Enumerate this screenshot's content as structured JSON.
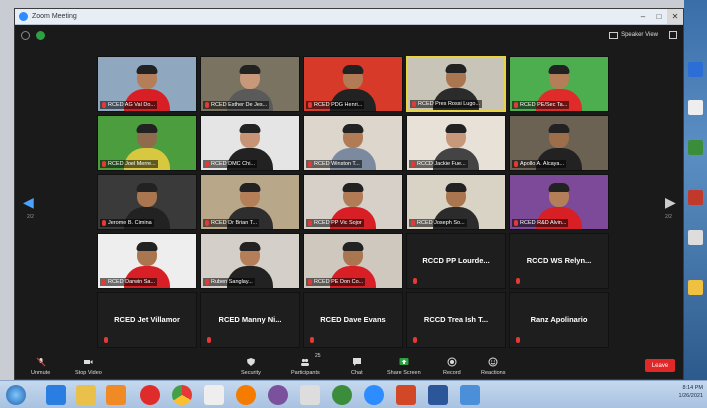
{
  "window": {
    "title": "Zoom Meeting",
    "speaker_view": "Speaker View"
  },
  "pages": {
    "left": "2/2",
    "right": "2/2"
  },
  "participants": [
    {
      "name": "RCED AG Val Do...",
      "bg": "#8fa8c0",
      "body": "#d81f26",
      "skin": "#b47f58"
    },
    {
      "name": "RCED Esther De Jes...",
      "bg": "#7a7361",
      "body": "#5a5a5a",
      "skin": "#c8987a"
    },
    {
      "name": "RCED PDG Henri...",
      "bg": "#d83a2a",
      "body": "#222",
      "skin": "#b07b55"
    },
    {
      "name": "RCED Pres Rossi Lugo...",
      "bg": "#c9c4b8",
      "body": "#2b2b2b",
      "skin": "#a9764f",
      "active": true
    },
    {
      "name": "RCED PE/Sec Ta...",
      "bg": "#4cae4f",
      "body": "#e02b2b",
      "skin": "#b47f58"
    },
    {
      "name": "RCED Joel Merre...",
      "bg": "#4b9d3e",
      "body": "#d8c840",
      "skin": "#8f6a4c"
    },
    {
      "name": "RCED DMC Chi...",
      "bg": "#e5e5e5",
      "body": "#222",
      "skin": "#c79576"
    },
    {
      "name": "RCED Winston T...",
      "bg": "#dcd6cc",
      "body": "#7c8aa0",
      "skin": "#b07b55"
    },
    {
      "name": "RCCD Jackie Fue...",
      "bg": "#e7e1d8",
      "body": "#444",
      "skin": "#c8987a"
    },
    {
      "name": "Apollo A. Alcaya...",
      "bg": "#6c6253",
      "body": "#222",
      "skin": "#9c6e4b"
    },
    {
      "name": "Jerome B. Cimina",
      "bg": "#3a3a3a",
      "body": "#222",
      "skin": "#a9764f"
    },
    {
      "name": "RCED Dr Brian T...",
      "bg": "#b9a78a",
      "body": "#2e2e2e",
      "skin": "#b47f58"
    },
    {
      "name": "RCED PP Vic Sojor",
      "bg": "#d6d0c8",
      "body": "#d81f26",
      "skin": "#b07b55"
    },
    {
      "name": "RCED Joseph So...",
      "bg": "#d9d3c5",
      "body": "#2b2b2b",
      "skin": "#a9764f"
    },
    {
      "name": "RCED R&D Alvin...",
      "bg": "#7d4a9a",
      "body": "#d81f26",
      "skin": "#b47f58"
    },
    {
      "name": "RCED Darwin Sa...",
      "bg": "#eeeeee",
      "body": "#d81f26",
      "skin": "#a9764f"
    },
    {
      "name": "Ruben Sanglay...",
      "bg": "#d4cfc8",
      "body": "#222",
      "skin": "#b47f58"
    },
    {
      "name": "RCED PE Don Co...",
      "bg": "#cfc8bf",
      "body": "#d81f26",
      "skin": "#a9764f"
    }
  ],
  "name_only": [
    "RCCD PP Lourde...",
    "RCCD WS Relyn...",
    "RCED Jet Villamor",
    "RCED Manny Ni...",
    "RCED Dave Evans",
    "RCCD Trea Ish T...",
    "Ranz Apolinario"
  ],
  "toolbar": {
    "unmute": "Unmute",
    "stop_video": "Stop Video",
    "security": "Security",
    "participants": "Participants",
    "participants_count": "25",
    "chat": "Chat",
    "share_screen": "Share Screen",
    "record": "Record",
    "reactions": "Reactions",
    "leave": "Leave"
  },
  "taskbar": {
    "time": "8:14 PM",
    "date": "1/26/2021"
  },
  "colors": {
    "accent": "#2d8cff",
    "leave": "#e02828",
    "active_speaker": "#e8d340",
    "share": "#2ea043"
  }
}
